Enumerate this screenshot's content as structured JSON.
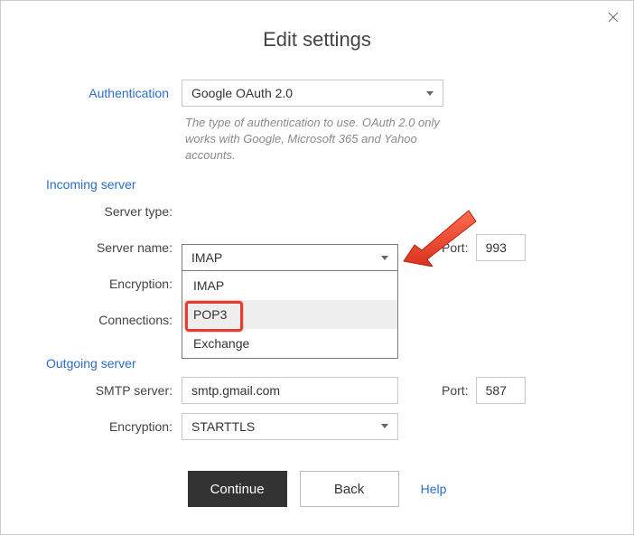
{
  "title": "Edit settings",
  "authentication": {
    "label": "Authentication",
    "value": "Google OAuth 2.0",
    "helper": "The type of authentication to use. OAuth 2.0 only works with Google, Microsoft 365 and Yahoo accounts."
  },
  "incoming": {
    "section": "Incoming server",
    "server_type_label": "Server type:",
    "server_type_value": "IMAP",
    "server_type_options": [
      "IMAP",
      "POP3",
      "Exchange"
    ],
    "server_name_label": "Server name:",
    "port_label": "Port:",
    "port_value": "993",
    "encryption_label": "Encryption:",
    "connections_label": "Connections:"
  },
  "outgoing": {
    "section": "Outgoing server",
    "smtp_label": "SMTP server:",
    "smtp_value": "smtp.gmail.com",
    "port_label": "Port:",
    "port_value": "587",
    "encryption_label": "Encryption:",
    "encryption_value": "STARTTLS"
  },
  "buttons": {
    "continue": "Continue",
    "back": "Back",
    "help": "Help"
  }
}
